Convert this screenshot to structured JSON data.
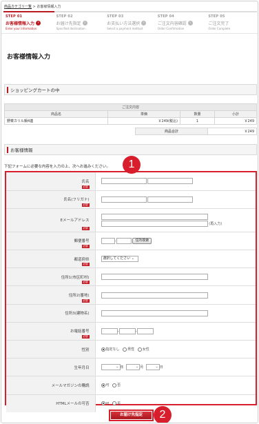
{
  "breadcrumb": {
    "link": "商品カテゴリー覧",
    "sep": ">",
    "current": "お客様情報入力"
  },
  "steps": [
    {
      "no": "STEP 01",
      "jp": "お客様情報入力",
      "en": "Enter your information"
    },
    {
      "no": "STEP 02",
      "jp": "お届け先指定",
      "en": "Specified destination"
    },
    {
      "no": "STEP 03",
      "jp": "お支払い方法選択",
      "en": "Select a payment method"
    },
    {
      "no": "STEP 04",
      "jp": "ご注文内容確認",
      "en": "Order Confirmation"
    },
    {
      "no": "STEP 05",
      "jp": "ご注文完了",
      "en": "Order Complete"
    }
  ],
  "page_title": "お客様情報入力",
  "cart": {
    "section_title": "ショッピングカートの中",
    "table_title": "ご注文内容",
    "headers": [
      "商品名",
      "単価",
      "数量",
      "小計"
    ],
    "rows": [
      {
        "name": "野菜カリル鍋4連",
        "price": "￥249(税込)",
        "qty": "1",
        "subtotal": "￥249"
      }
    ],
    "total_label": "商品合計",
    "total_value": "￥249"
  },
  "customer": {
    "section_title": "お客様情報",
    "note": "下記フォームに必要な内容を入力の上、次へお進みください。",
    "required": "必須",
    "fields": {
      "name": "氏名",
      "kana": "氏名(フリガナ)",
      "email": "Eメールアドレス",
      "email_confirm": "(再入力)",
      "zip": "郵便番号",
      "zip_button": "住所検索",
      "pref": "都道府県",
      "pref_select": "選択してください",
      "addr1": "住所1(市区町村)",
      "addr2": "住所2(番地)",
      "addr3": "住所3(建物名)",
      "tel": "お電話番号",
      "gender": "性別",
      "gender_options": [
        "指定なし",
        "男性",
        "女性"
      ],
      "birth": "生年月日",
      "birth_units": [
        "年",
        "月",
        "日"
      ],
      "mag": "メールマガジンの購読",
      "html": "HTMLメールの可否",
      "yesno": [
        "可",
        "否"
      ]
    }
  },
  "submit_label": "お届け先指定",
  "badges": [
    "1",
    "2"
  ]
}
